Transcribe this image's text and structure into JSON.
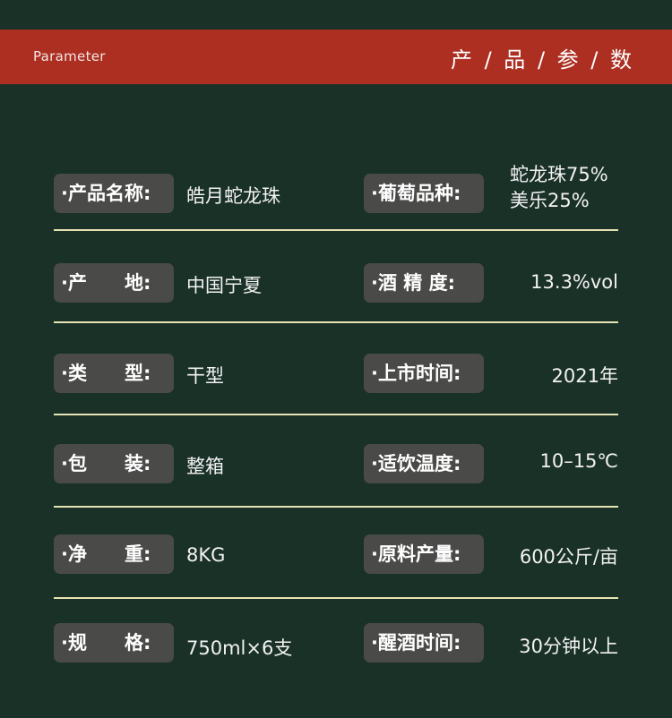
{
  "header": {
    "left_text": "Parameter",
    "right_text": "产 / 品 / 参 / 数"
  },
  "rows": [
    {
      "left": {
        "label": "·产品名称:",
        "value": "皓月蛇龙珠"
      },
      "right": {
        "label": "·葡萄品种:",
        "value": [
          "蛇龙珠75%",
          "美乐25%"
        ]
      }
    },
    {
      "left": {
        "label": "·产　　地:",
        "value": "中国宁夏"
      },
      "right": {
        "label": "·酒 精 度:",
        "value": "13.3%vol"
      }
    },
    {
      "left": {
        "label": "·类　　型:",
        "value": "干型"
      },
      "right": {
        "label": "·上市时间:",
        "value": "2021年"
      }
    },
    {
      "left": {
        "label": "·包　　装:",
        "value": "整箱"
      },
      "right": {
        "label": "·适饮温度:",
        "value": "10–15℃"
      }
    },
    {
      "left": {
        "label": "·净　　重:",
        "value": "8KG"
      },
      "right": {
        "label": "·原料产量:",
        "value": "600公斤/亩"
      }
    },
    {
      "left": {
        "label": "·规　　格:",
        "value": "750ml×6支"
      },
      "right": {
        "label": "·醒酒时间:",
        "value": "30分钟以上"
      }
    }
  ],
  "colors": {
    "background": "#1a3128",
    "banner": "#ac2f22",
    "label_bg": "#4a4a48",
    "divider": "#e8e3b4"
  }
}
